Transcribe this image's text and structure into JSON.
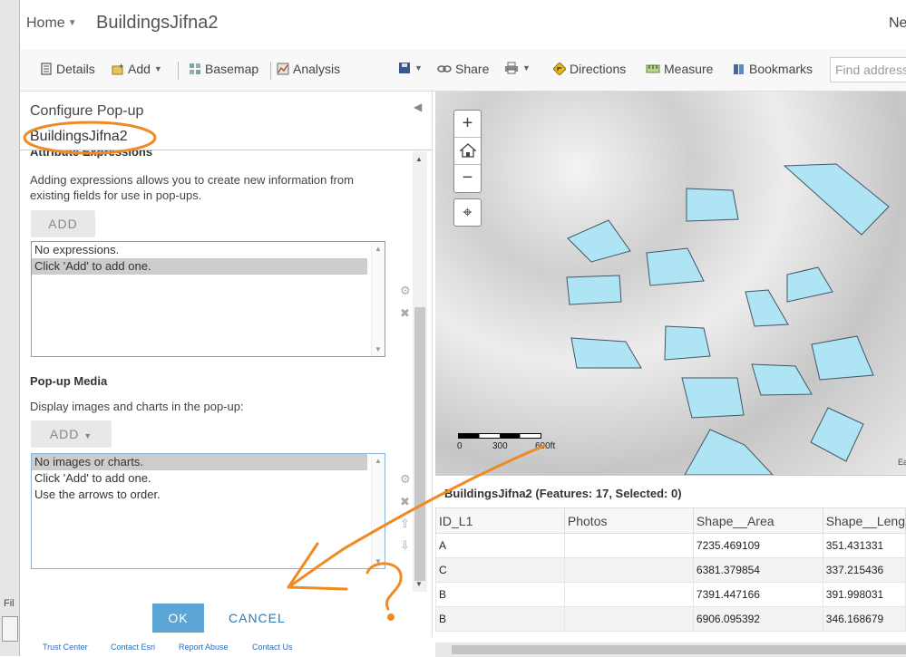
{
  "left_strip": {
    "text": "Fil"
  },
  "topnav": {
    "home": "Home",
    "title": "BuildingsJifna2",
    "right_truncated": "Ne"
  },
  "toolbar": {
    "details": "Details",
    "add": "Add",
    "basemap": "Basemap",
    "analysis": "Analysis",
    "share": "Share",
    "directions": "Directions",
    "measure": "Measure",
    "bookmarks": "Bookmarks",
    "find_placeholder": "Find address"
  },
  "panel": {
    "title": "Configure Pop-up",
    "layer_name": "BuildingsJifna2",
    "attr_expr": {
      "heading": "Attribute Expressions",
      "description": "Adding expressions allows you to create new information from existing fields for use in pop-ups.",
      "add_label": "ADD",
      "items": [
        "No expressions.",
        "Click 'Add' to add one."
      ]
    },
    "media": {
      "heading": "Pop-up Media",
      "description": "Display images and charts in the pop-up:",
      "add_label": "ADD",
      "items": [
        "No images or charts.",
        "Click 'Add' to add one.",
        "Use the arrows to order."
      ]
    },
    "ok": "OK",
    "cancel": "CANCEL"
  },
  "footer": {
    "links": [
      "Trust Center",
      "Contact Esri",
      "Report Abuse",
      "Contact Us"
    ]
  },
  "map": {
    "zoom_in": "+",
    "zoom_out": "−",
    "scale_labels": [
      "0",
      "300",
      "600ft"
    ],
    "attribution_truncated": "Ea",
    "polygon_fill": "#aee4f3",
    "polygon_stroke": "#445566"
  },
  "table": {
    "title": "BuildingsJifna2 (Features: 17, Selected: 0)",
    "columns": [
      "ID_L1",
      "Photos",
      "Shape__Area",
      "Shape__Leng"
    ],
    "rows": [
      [
        "A",
        "",
        "7235.469109",
        "351.431331"
      ],
      [
        "C",
        "",
        "6381.379854",
        "337.215436"
      ],
      [
        "B",
        "",
        "7391.447166",
        "391.998031"
      ],
      [
        "B",
        "",
        "6906.095392",
        "346.168679"
      ]
    ]
  },
  "annotation": {
    "color": "#f08a24",
    "question_mark": "?"
  },
  "colors": {
    "accent": "#5ba6d6",
    "link": "#2a7bb5"
  }
}
